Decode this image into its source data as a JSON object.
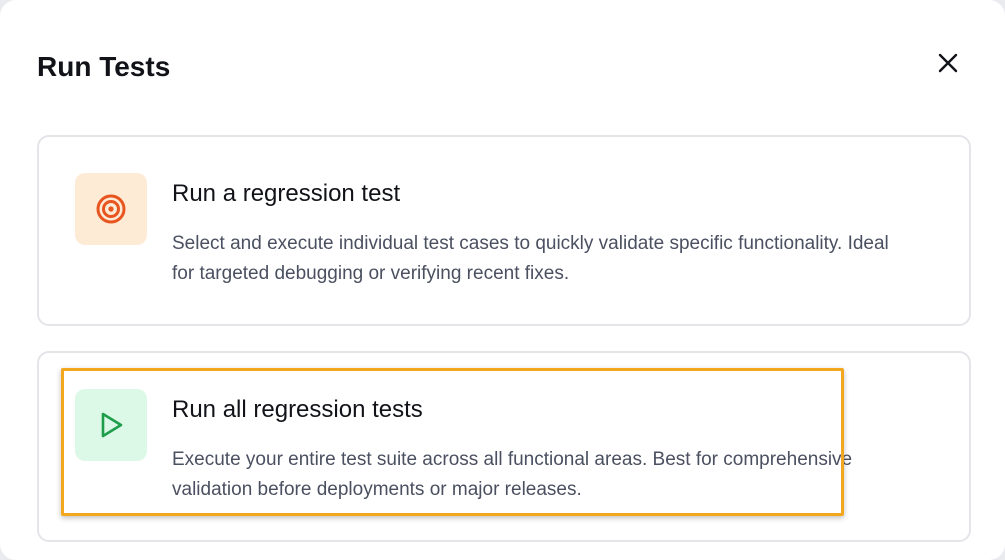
{
  "dialog": {
    "title": "Run Tests",
    "close_icon": "close-icon"
  },
  "options": [
    {
      "title": "Run a regression test",
      "description": "Select and execute individual test cases to quickly validate specific functionality. Ideal for targeted debugging or verifying recent fixes.",
      "icon": "target-icon",
      "icon_color": "#e8551f",
      "tile_color": "#fdebd6"
    },
    {
      "title": "Run all regression tests",
      "description": "Execute your entire test suite across all functional areas. Best for comprehensive validation before deployments or major releases.",
      "icon": "play-icon",
      "icon_color": "#1e9e4a",
      "tile_color": "#dcf8e6"
    }
  ],
  "highlight_color": "#f2a71e"
}
